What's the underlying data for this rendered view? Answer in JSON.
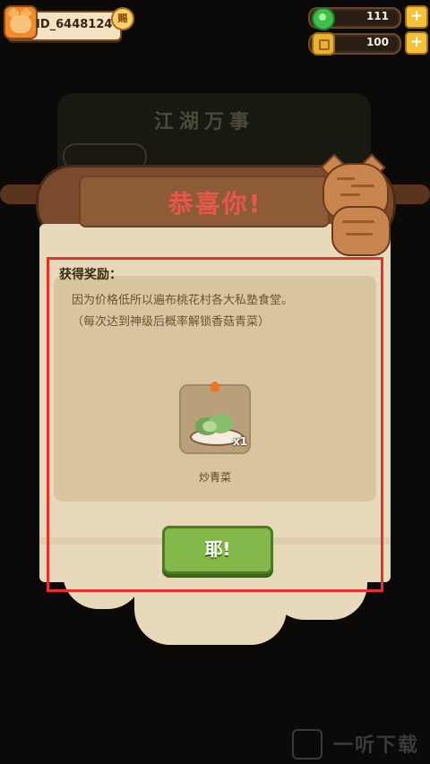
{
  "player": {
    "id": "ID_6448124",
    "vip_label": "赐"
  },
  "resources": [
    {
      "name": "jade",
      "icon": "green-gem-icon",
      "color": "#3fbf4a",
      "value": "111"
    },
    {
      "name": "coin",
      "icon": "gold-coin-icon",
      "color": "#e8b23a",
      "value": "100"
    }
  ],
  "background": {
    "title": "江湖万事"
  },
  "dialog": {
    "title": "恭喜你!",
    "reward_label": "获得奖励：",
    "description_line1": "因为价格低所以遍布桃花村各大私塾食堂。",
    "description_line2": "（每次达到神级后概率解锁香菇青菜）",
    "item": {
      "name": "炒青菜",
      "quantity": "x1",
      "icon": "stir-fried-greens-icon"
    },
    "confirm_label": "耶!"
  },
  "watermark": {
    "text": "一听下载"
  },
  "colors": {
    "highlight_border": "#e8302a",
    "confirm_button": "#84b84a",
    "title_text": "#e6584b"
  }
}
